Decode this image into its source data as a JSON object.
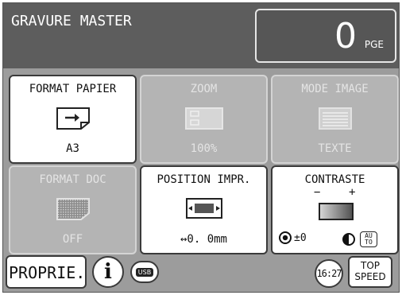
{
  "header": {
    "title": "GRAVURE MASTER",
    "counter_value": "0",
    "counter_unit": "PGE"
  },
  "tiles": [
    {
      "label": "FORMAT PAPIER",
      "value": "A3",
      "icon": "paper-arrow-icon",
      "active": true
    },
    {
      "label": "ZOOM",
      "value": "100%",
      "icon": "zoom-frame-icon",
      "active": false
    },
    {
      "label": "MODE IMAGE",
      "value": "TEXTE",
      "icon": "text-lines-icon",
      "active": false
    },
    {
      "label": "FORMAT DOC",
      "value": "OFF",
      "icon": "doc-hatched-icon",
      "active": false
    },
    {
      "label": "POSITION IMPR.",
      "value": "↔0. 0mm",
      "icon": "print-position-icon",
      "active": true
    },
    {
      "label": "CONTRASTE",
      "value": "",
      "icon": "contrast-gradient-icon",
      "active": true
    }
  ],
  "contrast": {
    "minus": "−",
    "plus": "+",
    "level": "±0",
    "auto_label_top": "AU",
    "auto_label_bottom": "TO"
  },
  "bottom": {
    "properties_label": "PROPRIE.",
    "info_glyph": "i",
    "usb_label": "USB",
    "clock": "16:27",
    "speed_line1": "TOP",
    "speed_line2": "SPEED"
  },
  "colors": {
    "header_bg": "#5d5d5d",
    "panel_bg": "#9c9c9c",
    "tile_disabled": "#b4b4b4",
    "tile_active": "#ffffff"
  }
}
